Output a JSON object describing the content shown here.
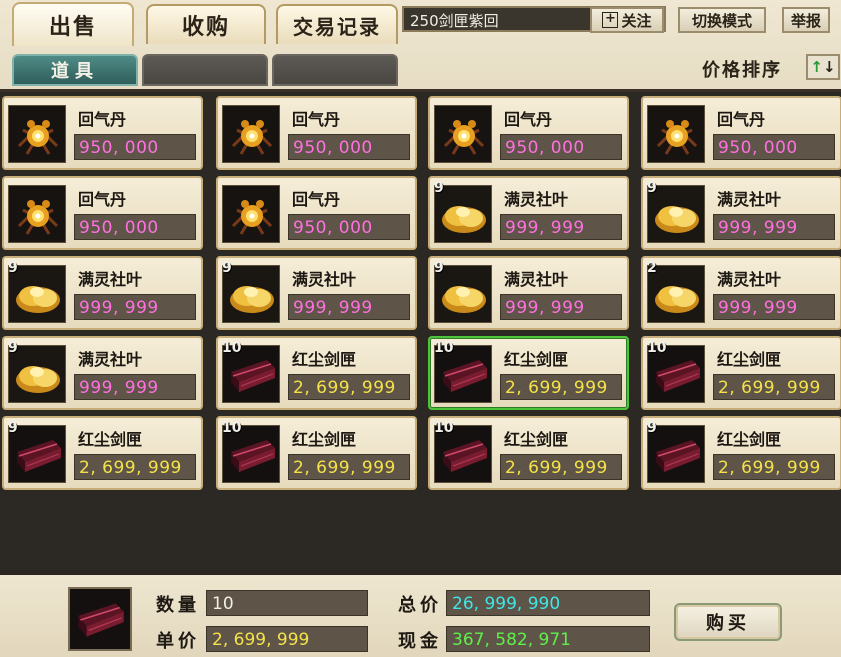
{
  "tabs": [
    {
      "label": "出售",
      "active": true
    },
    {
      "label": "收购",
      "active": false
    },
    {
      "label": "交易记录",
      "active": false
    }
  ],
  "search": {
    "value": "250剑匣紫回"
  },
  "buttons": {
    "follow": "关注",
    "follow_icon": "plus-icon",
    "switch_mode": "切换模式",
    "report": "举报"
  },
  "subtabs": [
    {
      "label": "道具",
      "active": true
    },
    {
      "label": "",
      "active": false
    },
    {
      "label": "",
      "active": false
    }
  ],
  "sort": {
    "label": "价格排序",
    "up_glyph": "↑",
    "down_glyph": "↓"
  },
  "colors": {
    "price_pink": "#ff6fe0",
    "price_yellow": "#f5e24a",
    "total_cyan": "#3ee6e6",
    "cash_green": "#5ef04a",
    "selected_border": "#4fc43b"
  },
  "items": [
    {
      "qty": "",
      "name": "回气丹",
      "price": "950, 000",
      "price_color": "pink",
      "icon": "pill-icon",
      "selected": false
    },
    {
      "qty": "",
      "name": "回气丹",
      "price": "950, 000",
      "price_color": "pink",
      "icon": "pill-icon",
      "selected": false
    },
    {
      "qty": "",
      "name": "回气丹",
      "price": "950, 000",
      "price_color": "pink",
      "icon": "pill-icon",
      "selected": false
    },
    {
      "qty": "",
      "name": "回气丹",
      "price": "950, 000",
      "price_color": "pink",
      "icon": "pill-icon",
      "selected": false
    },
    {
      "qty": "",
      "name": "回气丹",
      "price": "950, 000",
      "price_color": "pink",
      "icon": "pill-icon",
      "selected": false
    },
    {
      "qty": "",
      "name": "回气丹",
      "price": "950, 000",
      "price_color": "pink",
      "icon": "pill-icon",
      "selected": false
    },
    {
      "qty": "9",
      "name": "满灵社叶",
      "price": "999, 999",
      "price_color": "pink",
      "icon": "leaf-icon",
      "selected": false
    },
    {
      "qty": "9",
      "name": "满灵社叶",
      "price": "999, 999",
      "price_color": "pink",
      "icon": "leaf-icon",
      "selected": false
    },
    {
      "qty": "9",
      "name": "满灵社叶",
      "price": "999, 999",
      "price_color": "pink",
      "icon": "leaf-icon",
      "selected": false
    },
    {
      "qty": "9",
      "name": "满灵社叶",
      "price": "999, 999",
      "price_color": "pink",
      "icon": "leaf-icon",
      "selected": false
    },
    {
      "qty": "9",
      "name": "满灵社叶",
      "price": "999, 999",
      "price_color": "pink",
      "icon": "leaf-icon",
      "selected": false
    },
    {
      "qty": "2",
      "name": "满灵社叶",
      "price": "999, 999",
      "price_color": "pink",
      "icon": "leaf-icon",
      "selected": false
    },
    {
      "qty": "9",
      "name": "满灵社叶",
      "price": "999, 999",
      "price_color": "pink",
      "icon": "leaf-icon",
      "selected": false
    },
    {
      "qty": "10",
      "name": "红尘剑匣",
      "price": "2, 699, 999",
      "price_color": "yellow",
      "icon": "sword-box-icon",
      "selected": false
    },
    {
      "qty": "10",
      "name": "红尘剑匣",
      "price": "2, 699, 999",
      "price_color": "yellow",
      "icon": "sword-box-icon",
      "selected": true
    },
    {
      "qty": "10",
      "name": "红尘剑匣",
      "price": "2, 699, 999",
      "price_color": "yellow",
      "icon": "sword-box-icon",
      "selected": false
    },
    {
      "qty": "9",
      "name": "红尘剑匣",
      "price": "2, 699, 999",
      "price_color": "yellow",
      "icon": "sword-box-icon",
      "selected": false
    },
    {
      "qty": "10",
      "name": "红尘剑匣",
      "price": "2, 699, 999",
      "price_color": "yellow",
      "icon": "sword-box-icon",
      "selected": false
    },
    {
      "qty": "10",
      "name": "红尘剑匣",
      "price": "2, 699, 999",
      "price_color": "yellow",
      "icon": "sword-box-icon",
      "selected": false
    },
    {
      "qty": "9",
      "name": "红尘剑匣",
      "price": "2, 699, 999",
      "price_color": "yellow",
      "icon": "sword-box-icon",
      "selected": false
    }
  ],
  "purchase": {
    "icon": "sword-box-icon",
    "quantity_label": "数量",
    "quantity_value": "10",
    "unit_price_label": "单价",
    "unit_price_value": "2, 699, 999",
    "total_label": "总价",
    "total_value": "26, 999, 990",
    "cash_label": "现金",
    "cash_value": "367, 582, 971",
    "buy_label": "购买"
  }
}
